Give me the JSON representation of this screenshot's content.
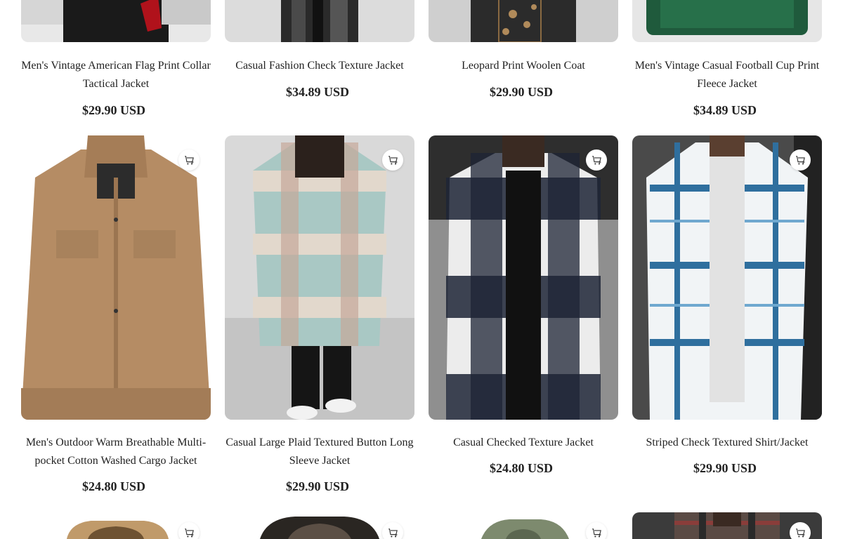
{
  "products": [
    {
      "title": "Men's Vintage American Flag Print Collar Tactical Jacket",
      "price": "$29.90 USD",
      "image": "jacket-black-red"
    },
    {
      "title": "Casual Fashion Check Texture Jacket",
      "price": "$34.89 USD",
      "image": "jacket-black-pattern"
    },
    {
      "title": "Leopard Print Woolen Coat",
      "price": "$29.90 USD",
      "image": "coat-leopard"
    },
    {
      "title": "Men's Vintage Casual Football Cup Print Fleece Jacket",
      "price": "$34.89 USD",
      "image": "jacket-green-fleece"
    },
    {
      "title": "Men's Outdoor Warm Breathable Multi-pocket Cotton Washed Cargo Jacket",
      "price": "$24.80 USD",
      "image": "jacket-khaki-cargo"
    },
    {
      "title": "Casual Large Plaid Textured Button Long Sleeve Jacket",
      "price": "$29.90 USD",
      "image": "jacket-mint-plaid"
    },
    {
      "title": "Casual Checked Texture Jacket",
      "price": "$24.80 USD",
      "image": "jacket-navy-check"
    },
    {
      "title": "Striped Check Textured Shirt/Jacket",
      "price": "$29.90 USD",
      "image": "shirt-blue-check"
    }
  ],
  "row3_images": [
    "jacket-tan-hood",
    "jacket-dark-sherpa",
    "jacket-olive-hood",
    "jacket-dark-check"
  ],
  "icons": {
    "cart": "add-to-cart-icon"
  },
  "colors": {
    "text": "#222222",
    "background": "#ffffff"
  }
}
